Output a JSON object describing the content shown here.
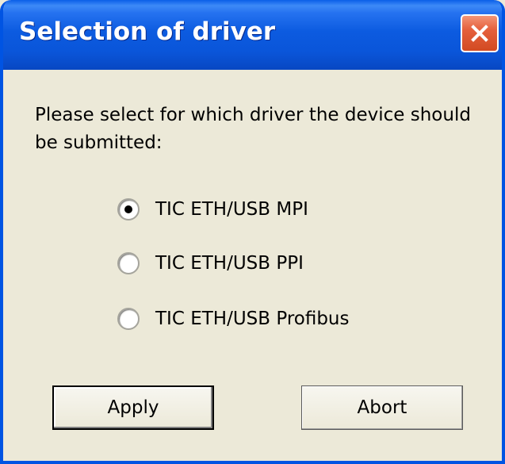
{
  "window": {
    "title": "Selection of driver",
    "close_icon": "close-icon"
  },
  "prompt": "Please select for which driver the device should be submitted:",
  "drivers": {
    "selected_index": 0,
    "options": [
      {
        "label": "TIC ETH/USB MPI",
        "selected": true
      },
      {
        "label": "TIC ETH/USB PPI",
        "selected": false
      },
      {
        "label": "TIC ETH/USB Profibus",
        "selected": false
      }
    ]
  },
  "buttons": {
    "apply_label": "Apply",
    "abort_label": "Abort"
  },
  "colors": {
    "titlebar": "#0054e3",
    "dialog_bg": "#ece9d8",
    "close_button": "#e5603c"
  }
}
